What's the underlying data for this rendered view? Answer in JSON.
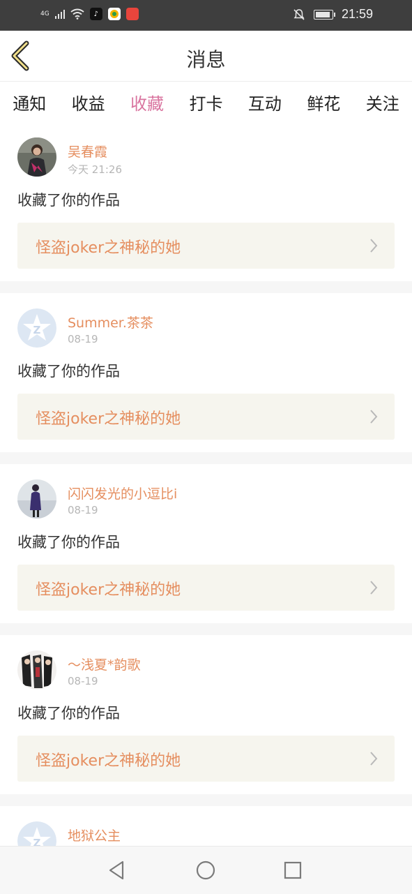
{
  "status_bar": {
    "network": "4G",
    "time": "21:59",
    "icons": [
      "signal-icon",
      "wifi-icon",
      "tiktok-app-icon",
      "weibo-app-icon",
      "red-app-icon",
      "mute-bell-icon",
      "battery-icon"
    ],
    "battery_level": 0.85
  },
  "header": {
    "title": "消息",
    "back_icon": "chevron-left-icon"
  },
  "tabs": [
    {
      "label": "通知",
      "active": false
    },
    {
      "label": "收益",
      "active": false
    },
    {
      "label": "收藏",
      "active": true
    },
    {
      "label": "打卡",
      "active": false
    },
    {
      "label": "互动",
      "active": false
    },
    {
      "label": "鲜花",
      "active": false
    },
    {
      "label": "关注",
      "active": false
    }
  ],
  "feed": [
    {
      "user": "吴春霞",
      "time": "今天 21:26",
      "action": "收藏了你的作品",
      "work": "怪盗joker之神秘的她",
      "avatar": "photo"
    },
    {
      "user": "Summer.茶茶",
      "time": "08-19",
      "action": "收藏了你的作品",
      "work": "怪盗joker之神秘的她",
      "avatar": "default"
    },
    {
      "user": "闪闪发光的小逗比i",
      "time": "08-19",
      "action": "收藏了你的作品",
      "work": "怪盗joker之神秘的她",
      "avatar": "photo"
    },
    {
      "user": "～浅夏*韵歌",
      "time": "08-19",
      "action": "收藏了你的作品",
      "work": "怪盗joker之神秘的她",
      "avatar": "photo"
    },
    {
      "user": "地狱公主",
      "time": "",
      "action": "",
      "work": "",
      "avatar": "default"
    }
  ],
  "colors": {
    "accent": "#d9749f",
    "username": "#e58e5f",
    "work_bg": "#f6f5ee"
  },
  "nav": {
    "icons": [
      "back-triangle-icon",
      "home-circle-icon",
      "recent-square-icon"
    ]
  }
}
